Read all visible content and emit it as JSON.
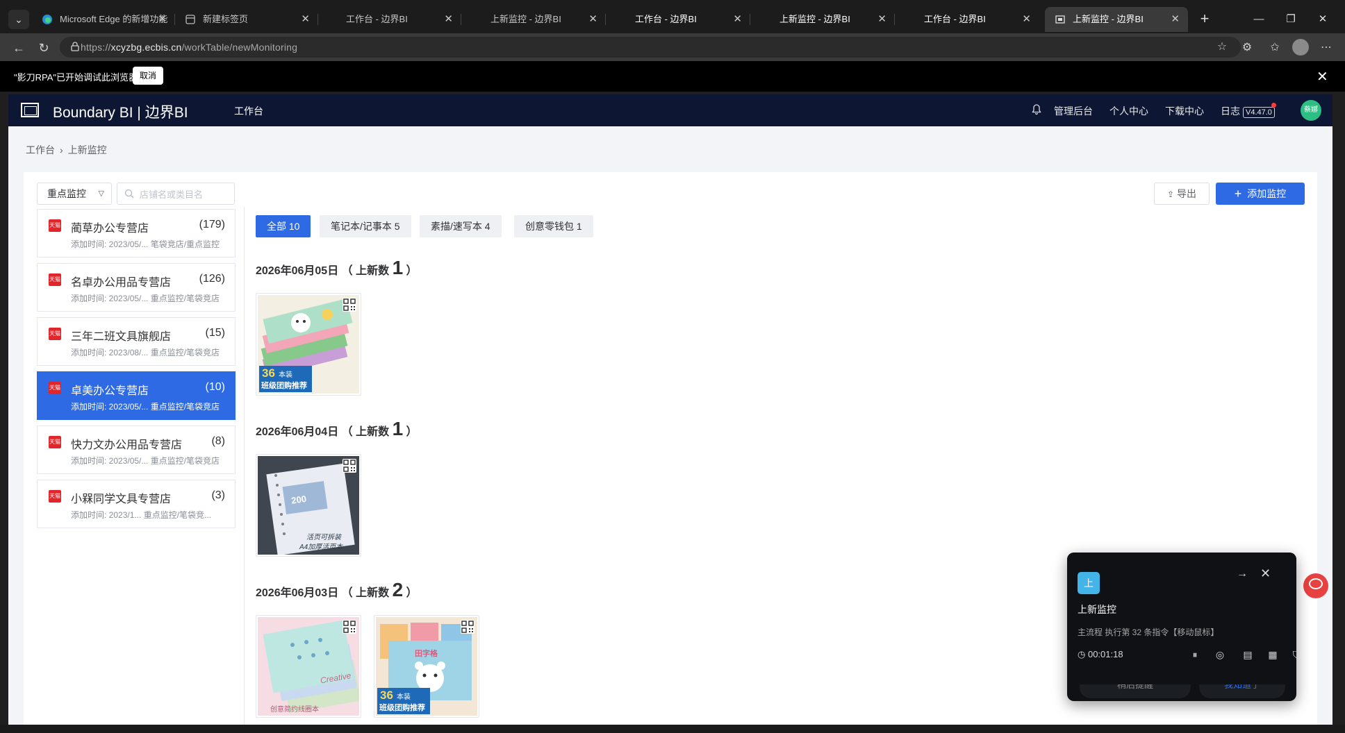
{
  "browser": {
    "tabs": [
      {
        "title": "Microsoft Edge 的新增功能",
        "active": false,
        "bright": false
      },
      {
        "title": "新建标签页",
        "active": false,
        "bright": false
      },
      {
        "title": "工作台 - 边界BI",
        "active": false,
        "bright": false
      },
      {
        "title": "上新监控 - 边界BI",
        "active": false,
        "bright": false
      },
      {
        "title": "工作台 - 边界BI",
        "active": false,
        "bright": true
      },
      {
        "title": "上新监控 - 边界BI",
        "active": false,
        "bright": true
      },
      {
        "title": "工作台 - 边界BI",
        "active": false,
        "bright": true
      },
      {
        "title": "上新监控 - 边界BI",
        "active": true,
        "bright": true
      }
    ],
    "url_prefix": "https://",
    "url_domain": "xcyzbg.ecbis.cn",
    "url_path": "/workTable/newMonitoring"
  },
  "rpa_notice": {
    "text": "\"影刀RPA\"已开始调试此浏览器",
    "cancel_label": "取消"
  },
  "app": {
    "brand": "Boundary BI | 边界BI",
    "nav_work": "工作台",
    "header_links": {
      "admin": "管理后台",
      "profile": "个人中心",
      "downloads": "下载中心",
      "log": "日志",
      "version": "V4.47.0"
    },
    "user_avatar_text": "蔡娜",
    "breadcrumb": {
      "root": "工作台",
      "current": "上新监控"
    }
  },
  "toolbar": {
    "filter_value": "重点监控",
    "search_placeholder": "店铺名或类目名",
    "export_label": "导出",
    "add_label": "添加监控"
  },
  "stores": [
    {
      "name": "蔺草办公专营店",
      "count": "(179)",
      "meta": "添加时间: 2023/05/... 笔袋竞店/重点监控",
      "active": false
    },
    {
      "name": "名卓办公用品专营店",
      "count": "(126)",
      "meta": "添加时间: 2023/05/... 重点监控/笔袋竞店",
      "active": false
    },
    {
      "name": "三年二班文具旗舰店",
      "count": "(15)",
      "meta": "添加时间: 2023/08/... 重点监控/笔袋竞店",
      "active": false
    },
    {
      "name": "卓美办公专营店",
      "count": "(10)",
      "meta": "添加时间: 2023/05/... 重点监控/笔袋竞店",
      "active": true
    },
    {
      "name": "快力文办公用品专营店",
      "count": "(8)",
      "meta": "添加时间: 2023/05/... 重点监控/笔袋竞店",
      "active": false
    },
    {
      "name": "小槑同学文具专营店",
      "count": "(3)",
      "meta": "添加时间: 2023/1... 重点监控/笔袋竞...",
      "active": false
    }
  ],
  "categories": [
    {
      "label": "全部 10",
      "active": true
    },
    {
      "label": "笔记本/记事本 5",
      "active": false
    },
    {
      "label": "素描/速写本 4",
      "active": false
    },
    {
      "label": "创意零钱包 1",
      "active": false
    }
  ],
  "date_groups": [
    {
      "date": "2026年06月05日",
      "prefix": "（ 上新数",
      "count": "1",
      "suffix": "）"
    },
    {
      "date": "2026年06月04日",
      "prefix": "（ 上新数",
      "count": "1",
      "suffix": "）"
    },
    {
      "date": "2026年06月03日",
      "prefix": "（ 上新数",
      "count": "2",
      "suffix": "）"
    }
  ],
  "product_images": {
    "p1": {
      "badge_num": "36",
      "badge_unit": "本装",
      "badge_line": "班级团购推荐"
    },
    "p2": {
      "cover_num": "200",
      "caption_1": "活页可拆装",
      "caption_2": "A4加厚活页本"
    },
    "p3": {
      "cover_word": "Creative",
      "caption": "创意简约线圈本"
    },
    "p4": {
      "badge_num": "36",
      "badge_unit": "本装",
      "badge_line": "班级团购推荐",
      "cover_word": "田字格"
    }
  },
  "rpa_popup": {
    "badge": "上",
    "title": "上新监控",
    "desc": "主流程 执行第 32 条指令【移动鼠标】",
    "timer": "00:01:18",
    "peek_left": "稍后提醒",
    "peek_right": "我知道了"
  },
  "colors": {
    "primary": "#2d6ae3",
    "header_bg": "#0d1733",
    "tmall_red": "#e0262b",
    "popup_bg": "#0f1114"
  },
  "icons": [
    "menu-chevron-icon",
    "edge-icon",
    "newtab-icon",
    "close-icon",
    "back-icon",
    "refresh-icon",
    "lock-icon",
    "star-icon",
    "extensions-icon",
    "favorites-icon",
    "more-icon",
    "bell-icon",
    "search-icon",
    "export-icon",
    "plus-icon",
    "tmall-icon",
    "qr-code-icon",
    "arrow-right-icon",
    "clock-icon",
    "pause-icon",
    "stop-icon",
    "log-icon",
    "table-icon",
    "shield-icon"
  ]
}
